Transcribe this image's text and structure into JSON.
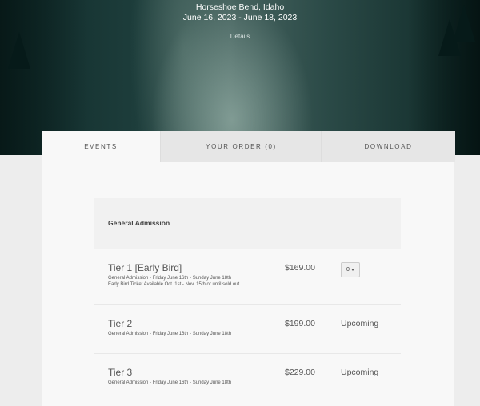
{
  "event": {
    "location": "Horseshoe Bend, Idaho",
    "dates": "June 16, 2023 - June 18, 2023",
    "details_link": "Details"
  },
  "tabs": [
    {
      "label": "EVENTS",
      "active": true
    },
    {
      "label": "YOUR ORDER (0)",
      "active": false
    },
    {
      "label": "DOWNLOAD",
      "active": false
    }
  ],
  "group": {
    "title": "General Admission"
  },
  "tickets": [
    {
      "name": "Tier 1 [Early Bird]",
      "description_lines": [
        "General Admission - Friday June 16th - Sunday June 18th",
        "Early Bird Ticket Available Oct. 1st - Nov. 15th or until sold out."
      ],
      "price": "$169.00",
      "quantity": "0"
    },
    {
      "name": "Tier 2",
      "description_lines": [
        "General Admission - Friday June 16th - Sunday June 18th"
      ],
      "price": "$199.00",
      "status": "Upcoming"
    },
    {
      "name": "Tier 3",
      "description_lines": [
        "General Admission - Friday June 16th - Sunday June 18th"
      ],
      "price": "$229.00",
      "status": "Upcoming"
    }
  ]
}
